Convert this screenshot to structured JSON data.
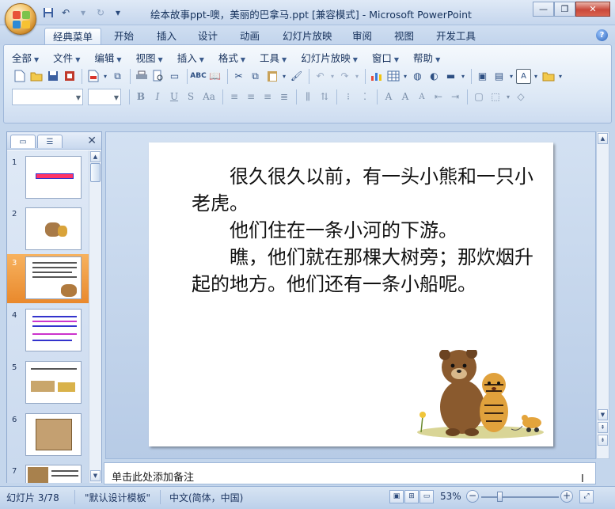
{
  "window": {
    "title": "绘本故事ppt-噢，美丽的巴拿马.ppt [兼容模式] - Microsoft PowerPoint"
  },
  "qat": {
    "icons": [
      "save-icon",
      "undo-icon",
      "redo-icon",
      "customize-icon"
    ]
  },
  "tabs": [
    {
      "label": "经典菜单",
      "active": true
    },
    {
      "label": "开始"
    },
    {
      "label": "插入"
    },
    {
      "label": "设计"
    },
    {
      "label": "动画"
    },
    {
      "label": "幻灯片放映"
    },
    {
      "label": "审阅"
    },
    {
      "label": "视图"
    },
    {
      "label": "开发工具"
    }
  ],
  "menu": [
    "全部",
    "文件",
    "编辑",
    "视图",
    "插入",
    "格式",
    "工具",
    "幻灯片放映",
    "窗口",
    "帮助"
  ],
  "font_box": {
    "value": ""
  },
  "size_box": {
    "value": ""
  },
  "format_buttons": {
    "bold": "B",
    "italic": "I",
    "underline": "U",
    "strike": "S",
    "case": "Aa"
  },
  "thumbnails": [
    {
      "num": "1"
    },
    {
      "num": "2"
    },
    {
      "num": "3",
      "selected": true
    },
    {
      "num": "4"
    },
    {
      "num": "5"
    },
    {
      "num": "6"
    },
    {
      "num": "7"
    }
  ],
  "slide": {
    "paragraphs": [
      "　　很久很久以前，有一头小熊和一只小老虎。",
      "　　他们住在一条小河的下游。",
      "　　瞧，他们就在那棵大树旁；那炊烟升起的地方。他们还有一条小船呢。"
    ]
  },
  "notes": {
    "placeholder": "单击此处添加备注"
  },
  "status": {
    "slide_info": "幻灯片 3/78",
    "template": "\"默认设计模板\"",
    "language": "中文(简体，中国)",
    "zoom": "53%"
  },
  "colors": {
    "accent": "#e9892c",
    "ribbon": "#dbe7f5"
  }
}
